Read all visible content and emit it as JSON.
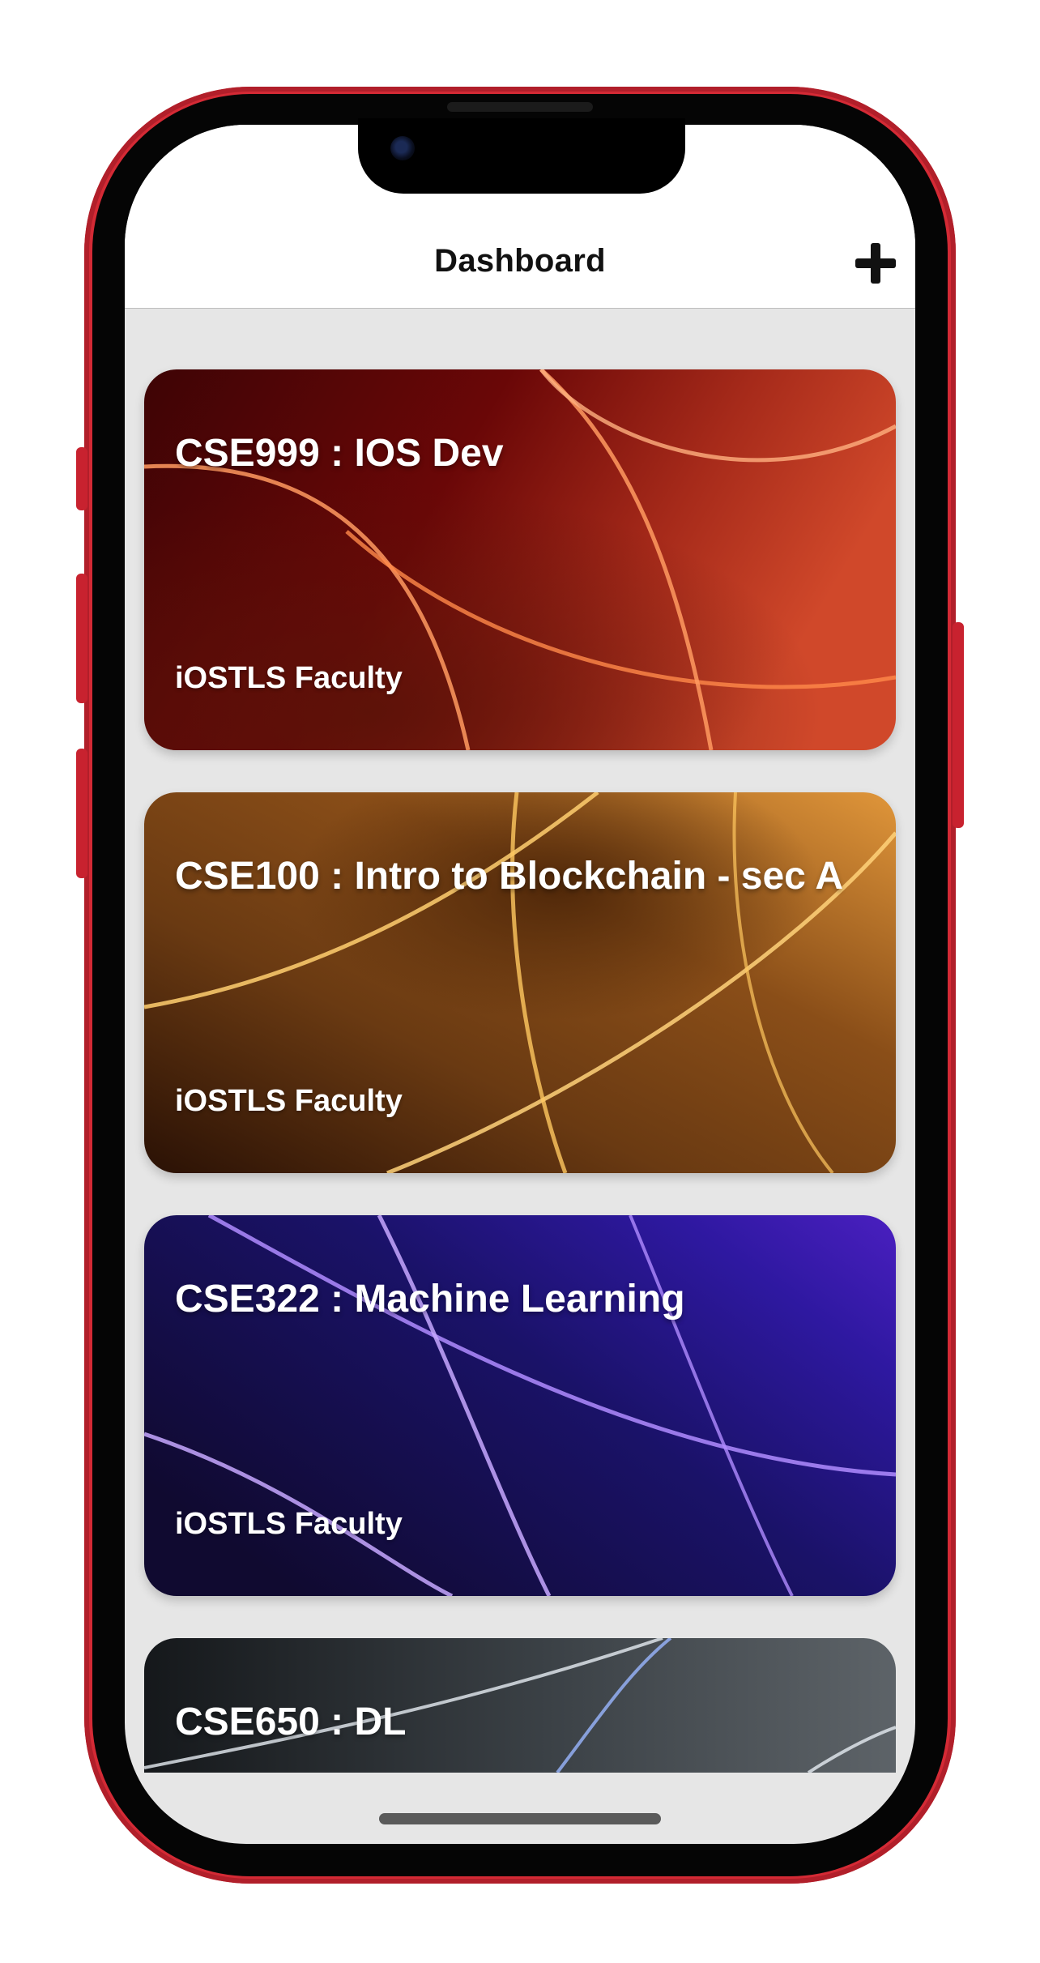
{
  "navbar": {
    "title": "Dashboard",
    "add_icon": "plus-icon"
  },
  "courses": [
    {
      "title": "CSE999 : IOS Dev",
      "subtitle": "iOSTLS Faculty",
      "theme": "red",
      "colors": [
        "#4a0506",
        "#7a0a08",
        "#c2391f",
        "#ff8a4a"
      ]
    },
    {
      "title": "CSE100 : Intro to Blockchain - sec A",
      "subtitle": "iOSTLS Faculty",
      "theme": "orange",
      "colors": [
        "#2a1105",
        "#6a3810",
        "#c2772a",
        "#ffd27a"
      ]
    },
    {
      "title": "CSE322 : Machine Learning",
      "subtitle": "iOSTLS Faculty",
      "theme": "purple",
      "colors": [
        "#120a3a",
        "#1c1470",
        "#3d1fb8",
        "#c7a8ff"
      ]
    },
    {
      "title": "CSE650 : DL",
      "subtitle": "",
      "theme": "gray",
      "colors": [
        "#15181b",
        "#3a3f44",
        "#6a7075",
        "#e6ecf2"
      ]
    }
  ],
  "device": {
    "frame_color": "#d42a35"
  }
}
